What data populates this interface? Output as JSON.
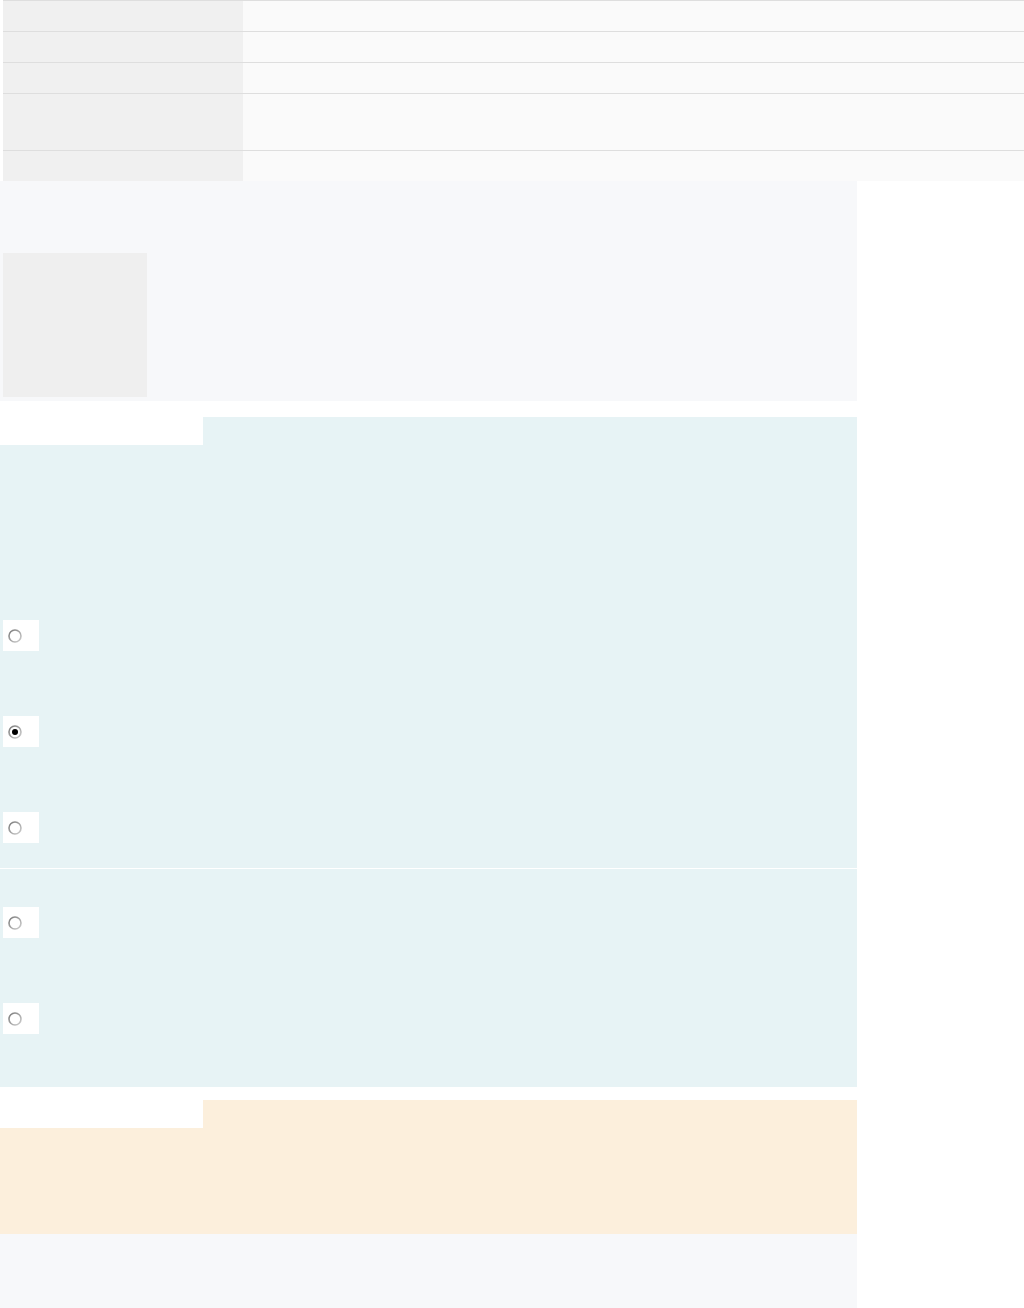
{
  "summary_table": {
    "rows": [
      {
        "kind": "short"
      },
      {
        "kind": "short"
      },
      {
        "kind": "short"
      },
      {
        "kind": "tall"
      },
      {
        "kind": "short"
      }
    ]
  },
  "answer_panel": {
    "sections": [
      {
        "options": [
          {
            "selected": false
          },
          {
            "selected": true
          },
          {
            "selected": false
          }
        ]
      },
      {
        "options": [
          {
            "selected": false
          },
          {
            "selected": false
          }
        ]
      }
    ]
  }
}
